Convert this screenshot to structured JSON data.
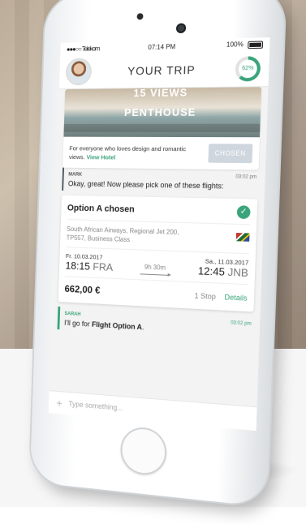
{
  "status_bar": {
    "carrier": "●●●○○ Telekom",
    "time": "07:14 PM",
    "battery": "100%"
  },
  "header": {
    "title": "YOUR TRIP",
    "progress_label": "62%",
    "progress_value": 0.62
  },
  "hotel": {
    "views": "15 VIEWS",
    "name": "PENTHOUSE",
    "description": "For everyone who loves design and romantic views.",
    "link": "View Hotel",
    "button": "CHOSEN"
  },
  "messages": [
    {
      "sender": "MARK",
      "time": "03:02 pm",
      "text": "Okay, great! Now please pick one of these flights:"
    },
    {
      "sender": "SARAH",
      "time": "03:02 pm",
      "text_prefix": "I'll go for ",
      "text_bold": "Flight Option A",
      "text_suffix": "."
    }
  ],
  "flight": {
    "title": "Option A chosen",
    "airline_line1": "South African Airways, Regional Jet 200,",
    "airline_line2": "TP557, Business Class",
    "depart_date": "Fr. 10.03.2017",
    "depart_time": "18:15",
    "depart_code": "FRA",
    "duration": "9h 30m",
    "arrive_date": "Sa., 11.03.2017",
    "arrive_time": "12:45",
    "arrive_code": "JNB",
    "price": "662,00 €",
    "stops": "1 Stop",
    "details": "Details"
  },
  "input": {
    "placeholder": "Type something..."
  },
  "colors": {
    "accent": "#3aa47b",
    "chosen_button": "#cfd6de"
  },
  "icons": [
    "plus-icon",
    "check-icon",
    "battery-icon",
    "airline-flag-icon"
  ]
}
